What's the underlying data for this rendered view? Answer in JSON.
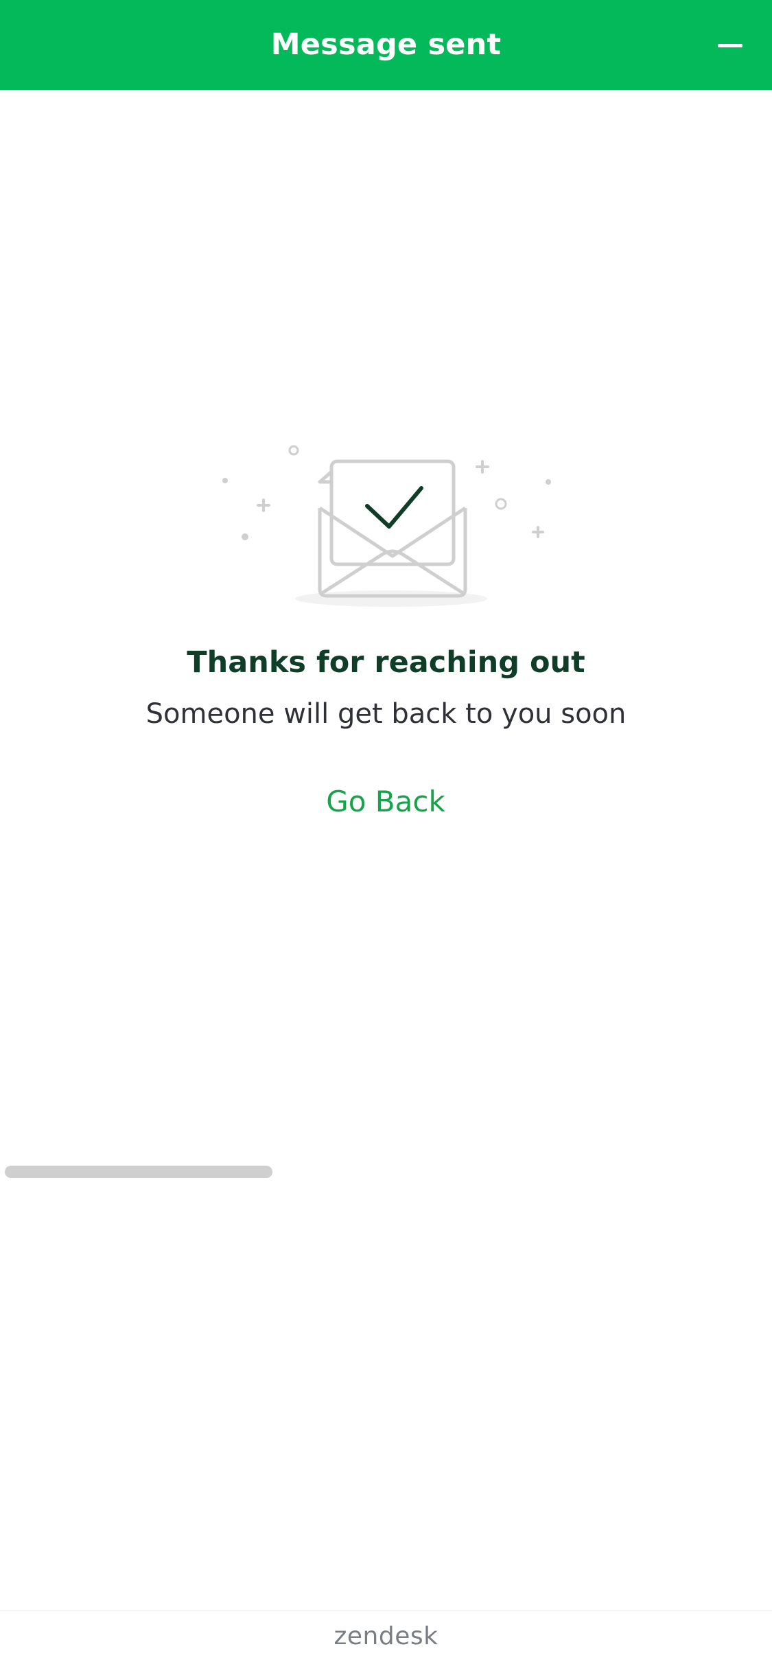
{
  "header": {
    "title": "Message sent",
    "minimize_icon": "minus-icon",
    "background_color": "#03b95a"
  },
  "illustration": {
    "icon": "envelope-check-icon"
  },
  "main": {
    "title": "Thanks for reaching out",
    "subtitle": "Someone will get back to you soon",
    "go_back_label": "Go Back"
  },
  "footer": {
    "brand": "zendesk"
  },
  "colors": {
    "accent": "#03b95a",
    "title": "#0f3d28",
    "link": "#16a34a",
    "muted": "#7a7e83"
  }
}
